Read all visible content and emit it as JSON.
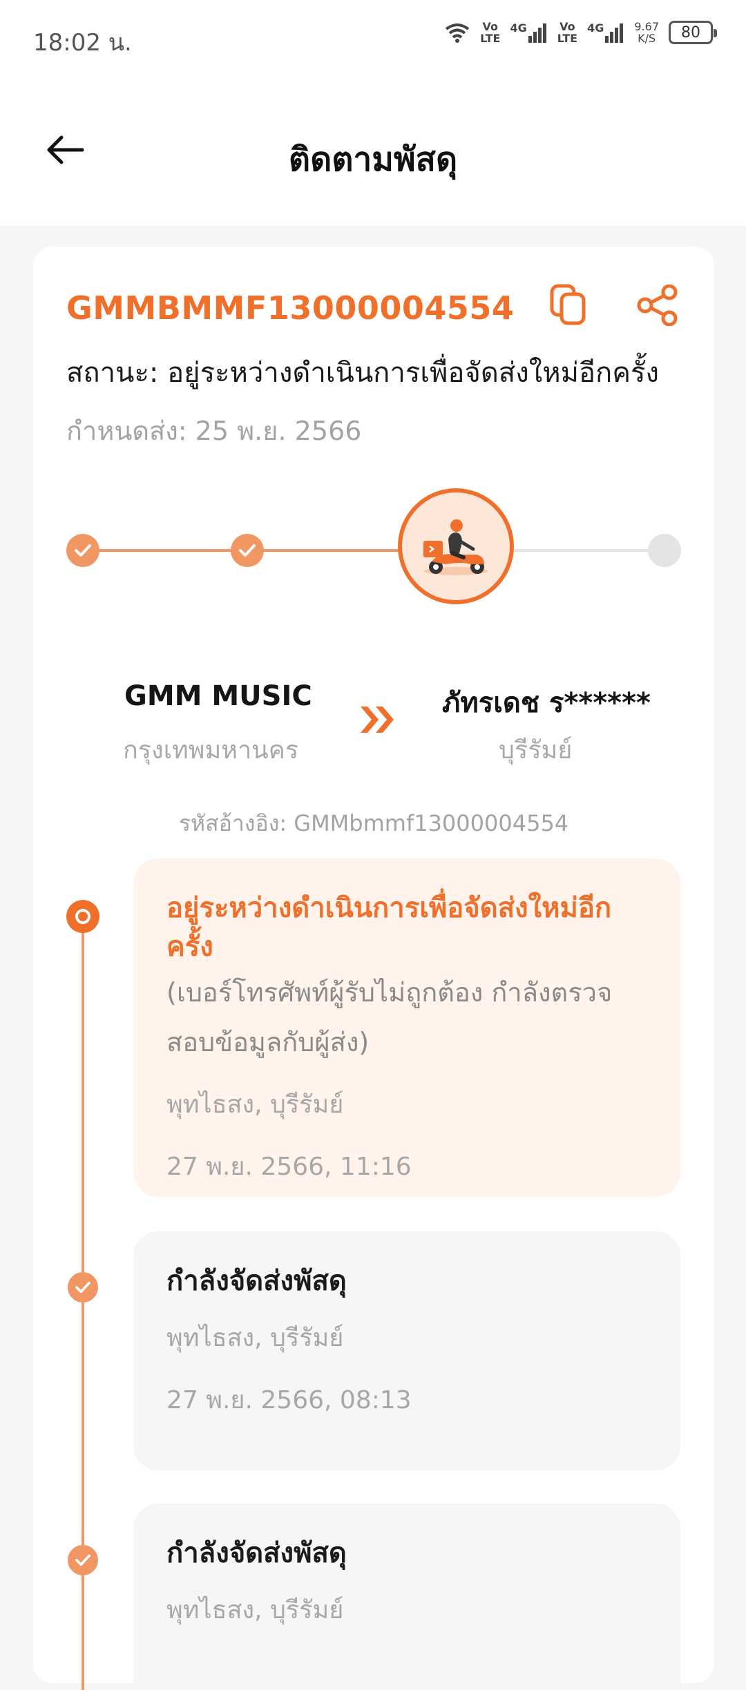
{
  "status_bar": {
    "time": "18:02 น.",
    "volte1_top": "Vo",
    "volte1_bottom": "LTE",
    "net1": "4G",
    "volte2_top": "Vo",
    "volte2_bottom": "LTE",
    "net2": "4G",
    "speed_value": "9.67",
    "speed_unit": "K/S",
    "battery": "80"
  },
  "header": {
    "title": "ติดตามพัสดุ"
  },
  "shipment": {
    "tracking_number": "GMMBMMF13000004554",
    "status_text": "สถานะ: อยู่ระหว่างดำเนินการเพื่อจัดส่งใหม่อีกครั้ง",
    "due_text": "กำหนดส่ง: 25 พ.ย. 2566",
    "progress": {
      "total_steps": 4,
      "completed_steps": 2,
      "current_step": 3
    },
    "sender_name": "GMM MUSIC",
    "sender_city": "กรุงเทพมหานคร",
    "receiver_name": "ภัทรเดช ร******",
    "receiver_city": "บุรีรัมย์",
    "reference": "รหัสอ้างอิง: GMMbmmf13000004554"
  },
  "colors": {
    "accent": "#ef6f2b",
    "accent_light": "#f19763",
    "active_card_bg": "#fff3ec",
    "card_bg": "#f6f6f6"
  },
  "events": [
    {
      "title": "อยู่ระหว่างดำเนินการเพื่อจัดส่งใหม่อีกครั้ง",
      "detail_line1": "(เบอร์โทรศัพท์ผู้รับไม่ถูกต้อง กำลังตรวจ",
      "detail_line2": "สอบข้อมูลกับผู้ส่ง)",
      "location": "พุทไธสง, บุรีรัมย์",
      "time": "27 พ.ย. 2566, 11:16"
    },
    {
      "title": "กำลังจัดส่งพัสดุ",
      "location": "พุทไธสง, บุรีรัมย์",
      "time": "27 พ.ย. 2566, 08:13"
    },
    {
      "title": "กำลังจัดส่งพัสดุ",
      "location": "พุทไธสง, บุรีรัมย์"
    }
  ]
}
